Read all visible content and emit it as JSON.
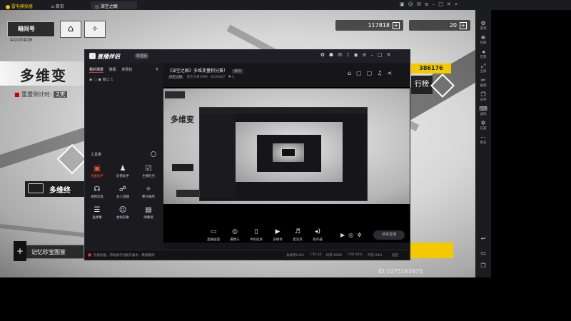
{
  "titlebar": {
    "app_name": "雷电模拟器",
    "tab_home": "首页",
    "tab_game": "深空之眼"
  },
  "emulator_sidebar": [
    {
      "label": "游戏",
      "icon": "gamepad-icon"
    },
    {
      "label": "加速",
      "icon": "speed-icon"
    },
    {
      "label": "音量",
      "icon": "volume-icon"
    },
    {
      "label": "全屏",
      "icon": "fullscreen-icon"
    },
    {
      "label": "截图",
      "icon": "scissors-icon"
    },
    {
      "label": "多开",
      "icon": "multi-icon"
    },
    {
      "label": "虚拟",
      "icon": "keyboard-icon"
    },
    {
      "label": "设置",
      "icon": "gear-icon"
    },
    {
      "label": "更多",
      "icon": "more-icon"
    }
  ],
  "game": {
    "player_tag": "暗间号",
    "player_id": "4100408",
    "currency1": "117818",
    "currency2": "20",
    "title": "多维变",
    "countdown_label": "重置倒计时:",
    "countdown_value": "2天",
    "score": "386176",
    "rank_label": "行榜",
    "mode_label": "多维终",
    "collection_label": "记忆珍宝图鉴",
    "uid": "ID:1075183975"
  },
  "stream_app": {
    "logo": "直播伴侣",
    "version": "体验版",
    "room_title": "《深空之眼》多维变量积分赛！",
    "room_edit": "修改",
    "category": "深空之眼",
    "anchor": "星芒大海1996",
    "fans": "6100407",
    "likes": "5",
    "tabs": [
      "我的场景",
      "弹幕",
      "表情包"
    ],
    "scene_item": "窗口 1",
    "toolbox_label": "工具箱",
    "tools": [
      {
        "label": "连麦助手",
        "icon": "mic-link-icon"
      },
      {
        "label": "房管助手",
        "icon": "admin-icon"
      },
      {
        "label": "主播任务",
        "icon": "task-icon"
      },
      {
        "label": "视频连麦",
        "icon": "video-link-icon"
      },
      {
        "label": "多人直播",
        "icon": "multi-live-icon"
      },
      {
        "label": "整点抽奖",
        "icon": "lottery-icon"
      },
      {
        "label": "送弹幕",
        "icon": "danmaku-icon"
      },
      {
        "label": "虚拟形象",
        "icon": "avatar-icon"
      },
      {
        "label": "弹幕墙",
        "icon": "wall-icon"
      }
    ],
    "bottom_tools": [
      {
        "label": "直播画面",
        "icon": "screen-icon"
      },
      {
        "label": "摄像头",
        "icon": "camera-icon"
      },
      {
        "label": "手机投屏",
        "icon": "phone-cast-icon"
      },
      {
        "label": "多媒体",
        "icon": "media-icon"
      },
      {
        "label": "麦克风",
        "icon": "microphone-icon"
      },
      {
        "label": "扬声器",
        "icon": "speaker-icon"
      }
    ],
    "notice": "礼物功能，求助助手功能升级中，敬请期待",
    "end_button": "结束直播",
    "stats": [
      "丢帧率0.0%",
      "FPS:30",
      "码率:6000",
      "CPU:16%",
      "内存:28%",
      "延迟"
    ]
  }
}
